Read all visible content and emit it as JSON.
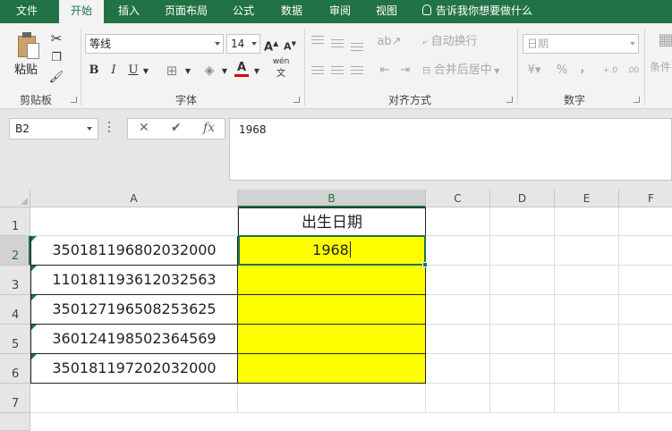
{
  "tabs": {
    "file": "文件",
    "home": "开始",
    "insert": "插入",
    "layout": "页面布局",
    "formulas": "公式",
    "data": "数据",
    "review": "审阅",
    "view": "视图",
    "tell_me": "告诉我你想要做什么"
  },
  "ribbon": {
    "clipboard": {
      "paste": "粘贴",
      "label": "剪贴板"
    },
    "font": {
      "name": "等线",
      "size": "14",
      "grow": "A",
      "shrink": "A",
      "bold": "B",
      "italic": "I",
      "underline": "U",
      "font_color": "A",
      "phonetic": "wén",
      "label": "字体"
    },
    "alignment": {
      "wrap_text": "自动换行",
      "merge_center": "合并后居中",
      "label": "对齐方式"
    },
    "number": {
      "format": "日期",
      "percent": "%",
      "comma": ",",
      "inc_decimal": "+.0",
      "dec_decimal": ".00",
      "label": "数字"
    },
    "styles": {
      "conditional": "条件"
    }
  },
  "formula_bar": {
    "name_box": "B2",
    "cancel": "✕",
    "enter": "✔",
    "fx": "fx",
    "content": "1968"
  },
  "columns": [
    "A",
    "B",
    "C",
    "D",
    "E",
    "F"
  ],
  "rows": [
    "1",
    "2",
    "3",
    "4",
    "5",
    "6",
    "7"
  ],
  "sheet": {
    "header_b1": "出生日期",
    "ids": [
      "350181196802032000",
      "110181193612032563",
      "350127196508253625",
      "360124198502364569",
      "350181197202032000"
    ],
    "b2": "1968"
  },
  "colors": {
    "accent": "#217346",
    "highlight": "#ffff00"
  }
}
